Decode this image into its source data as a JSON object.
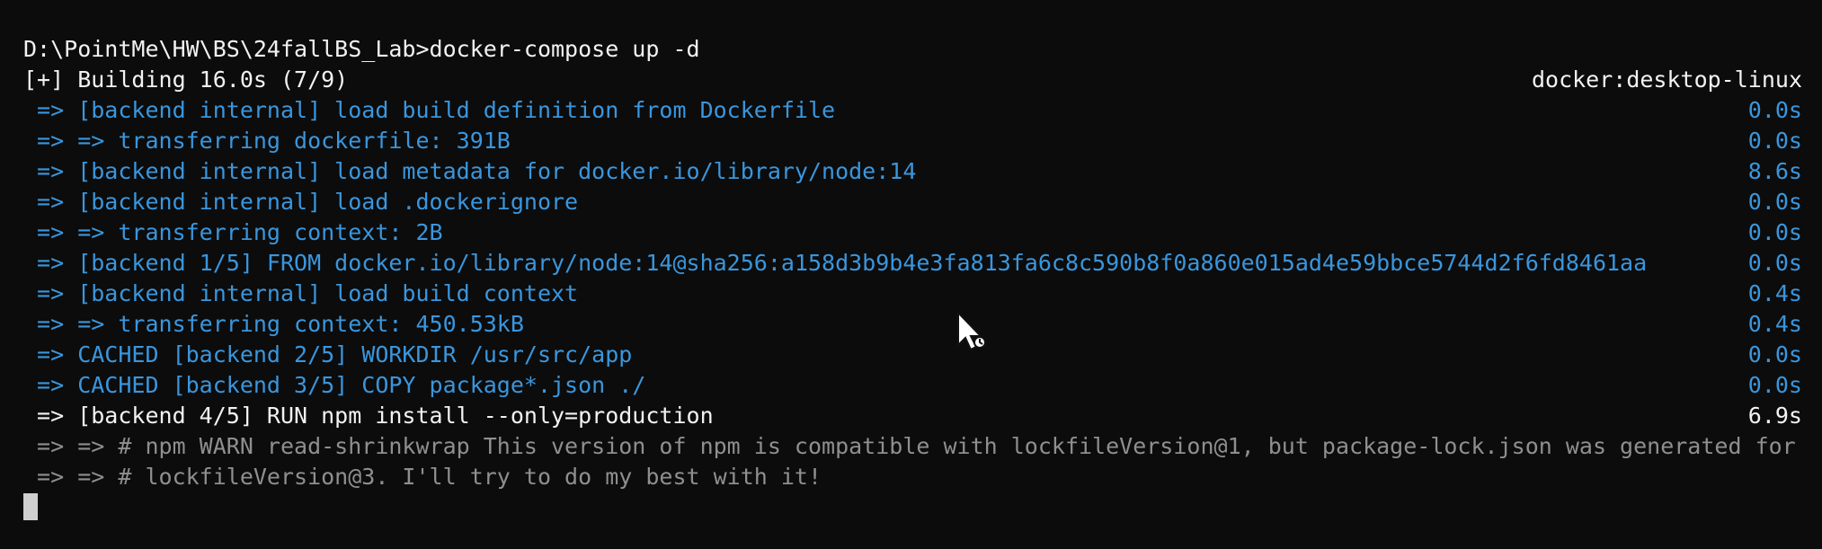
{
  "terminal": {
    "cut_top_line": "  ...  ",
    "lines": [
      {
        "left": "D:\\PointMe\\HW\\BS\\24fallBS_Lab>docker-compose up -d",
        "right": "",
        "color": "white"
      },
      {
        "left": "[+] Building 16.0s (7/9)",
        "right": "docker:desktop-linux",
        "color": "white"
      },
      {
        "left": " => [backend internal] load build definition from Dockerfile",
        "right": "0.0s",
        "color": "blue"
      },
      {
        "left": " => => transferring dockerfile: 391B",
        "right": "0.0s",
        "color": "blue"
      },
      {
        "left": " => [backend internal] load metadata for docker.io/library/node:14",
        "right": "8.6s",
        "color": "blue"
      },
      {
        "left": " => [backend internal] load .dockerignore",
        "right": "0.0s",
        "color": "blue"
      },
      {
        "left": " => => transferring context: 2B",
        "right": "0.0s",
        "color": "blue"
      },
      {
        "left": " => [backend 1/5] FROM docker.io/library/node:14@sha256:a158d3b9b4e3fa813fa6c8c590b8f0a860e015ad4e59bbce5744d2f6fd8461aa",
        "right": "0.0s",
        "color": "blue"
      },
      {
        "left": " => [backend internal] load build context",
        "right": "0.4s",
        "color": "blue"
      },
      {
        "left": " => => transferring context: 450.53kB",
        "right": "0.4s",
        "color": "blue"
      },
      {
        "left": " => CACHED [backend 2/5] WORKDIR /usr/src/app",
        "right": "0.0s",
        "color": "blue"
      },
      {
        "left": " => CACHED [backend 3/5] COPY package*.json ./",
        "right": "0.0s",
        "color": "blue"
      },
      {
        "left": " => [backend 4/5] RUN npm install --only=production",
        "right": "6.9s",
        "color": "white"
      },
      {
        "left": " => => # npm WARN read-shrinkwrap This version of npm is compatible with lockfileVersion@1, but package-lock.json was generated for",
        "right": "",
        "color": "gray"
      },
      {
        "left": " => => # lockfileVersion@3. I'll try to do my best with it!",
        "right": "",
        "color": "gray"
      }
    ]
  },
  "colors": {
    "background": "#0c0c0c",
    "blue": "#3a96dd",
    "white": "#f2f2f2",
    "gray": "#8f8f8f"
  },
  "icons": {
    "pointer": "mouse-pointer-icon",
    "cursor": "text-cursor-block"
  }
}
